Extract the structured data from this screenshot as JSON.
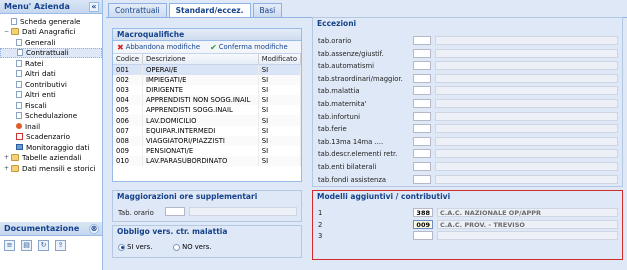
{
  "sidebar": {
    "title": "Menu' Azienda",
    "items": [
      {
        "label": "Scheda generale",
        "icon": "document-icon",
        "level": 0
      },
      {
        "label": "Dati Anagrafici",
        "icon": "folder-icon",
        "level": 0,
        "expanded": true
      },
      {
        "label": "Generali",
        "icon": "document-icon",
        "level": 1
      },
      {
        "label": "Contrattuali",
        "icon": "document-icon",
        "level": 1,
        "selected": true
      },
      {
        "label": "Ratei",
        "icon": "document-icon",
        "level": 1
      },
      {
        "label": "Altri dati",
        "icon": "document-icon",
        "level": 1
      },
      {
        "label": "Contributivi",
        "icon": "document-icon",
        "level": 1
      },
      {
        "label": "Altri enti",
        "icon": "document-icon",
        "level": 1
      },
      {
        "label": "Fiscali",
        "icon": "document-icon",
        "level": 1
      },
      {
        "label": "Schedulazione",
        "icon": "document-icon",
        "level": 1
      },
      {
        "label": "Inail",
        "icon": "pin-icon",
        "level": 1
      },
      {
        "label": "Scadenzario",
        "icon": "calendar-icon",
        "level": 1
      },
      {
        "label": "Monitoraggio dati",
        "icon": "monitor-icon",
        "level": 1
      },
      {
        "label": "Tabelle aziendali",
        "icon": "folder-icon",
        "level": 0
      },
      {
        "label": "Dati mensili e storici",
        "icon": "folder-icon",
        "level": 0
      }
    ],
    "collapse_glyph": "«"
  },
  "documentazione": {
    "title": "Documentazione",
    "collapse_glyph": "⊗"
  },
  "tabs": [
    {
      "label": "Contrattuali",
      "active": false
    },
    {
      "label": "Standard/eccez.",
      "active": true
    },
    {
      "label": "Basi",
      "active": false
    }
  ],
  "macro": {
    "title": "Macroqualifiche",
    "abbandona": "Abbandona modifiche",
    "conferma": "Conferma modifiche",
    "columns": [
      "Codice",
      "Descrizione",
      "Modificato"
    ],
    "rows": [
      [
        "001",
        "OPERAI/E",
        "SI"
      ],
      [
        "002",
        "IMPIEGATI/E",
        "SI"
      ],
      [
        "003",
        "DIRIGENTE",
        "SI"
      ],
      [
        "004",
        "APPRENDISTI NON SOGG.INAIL",
        "SI"
      ],
      [
        "005",
        "APPRENDISTI SOGG.INAIL",
        "SI"
      ],
      [
        "006",
        "LAV.DOMICILIO",
        "SI"
      ],
      [
        "007",
        "EQUIPAR.INTERMEDI",
        "SI"
      ],
      [
        "008",
        "VIAGGIATORI/PIAZZISTI",
        "SI"
      ],
      [
        "009",
        "PENSIONATI/E",
        "SI"
      ],
      [
        "010",
        "LAV.PARASUBORDINATO",
        "SI"
      ]
    ]
  },
  "maggiorazioni": {
    "title": "Maggiorazioni ore supplementari",
    "label": "Tab. orario"
  },
  "obbligo": {
    "title": "Obbligo vers. ctr. malattia",
    "si": "SI vers.",
    "no": "NO vers.",
    "selected": "si"
  },
  "eccezioni": {
    "title": "Eccezioni",
    "rows": [
      "tab.orario",
      "tab.assenze/giustif.",
      "tab.automatismi",
      "tab.straordinari/maggior.",
      "tab.malattia",
      "tab.maternita'",
      "tab.infortuni",
      "tab.ferie",
      "tab.13ma 14ma ....",
      "tab.descr.elementi retr.",
      "tab.enti bilaterali",
      "tab.fondi assistenza"
    ]
  },
  "modelli": {
    "title": "Modelli aggiuntivi / contributivi",
    "rows": [
      {
        "n": "1",
        "code": "388",
        "desc": "C.A.C. NAZIONALE OP/APPR"
      },
      {
        "n": "2",
        "code": "009",
        "desc": "C.A.C. PROV. - TREVISO"
      },
      {
        "n": "3",
        "code": "",
        "desc": ""
      }
    ]
  }
}
